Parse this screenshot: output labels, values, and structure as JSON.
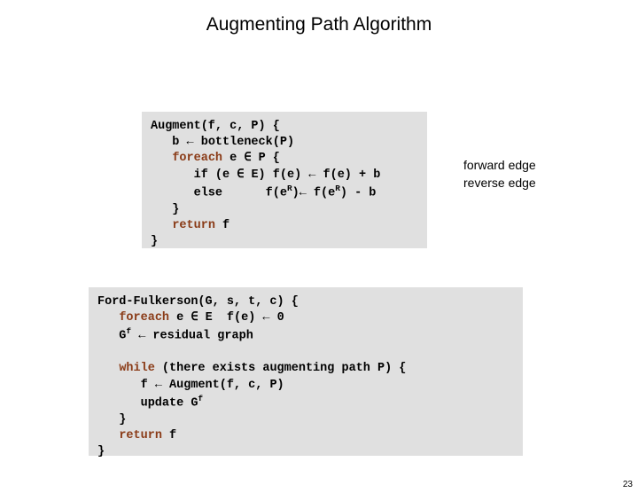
{
  "title": "Augmenting Path Algorithm",
  "augment": {
    "l1a": "Augment(f, c, P) {",
    "l2a": "   b ",
    "l2b": " bottleneck(P)",
    "l3a": "   ",
    "l3kw": "foreach",
    "l3b": " e ",
    "l3c": " P {",
    "l4a": "      if (e ",
    "l4b": " E) f(e) ",
    "l4c": " f(e) + b",
    "l5a": "      else      f(e",
    "l5sup": "R",
    "l5b": ")",
    "l5c": " f(e",
    "l5sup2": "R",
    "l5d": ") - b",
    "l6": "   }",
    "l7a": "   ",
    "l7kw": "return",
    "l7b": " f",
    "l8": "}"
  },
  "annotations": {
    "forward": "forward edge",
    "reverse": "reverse edge"
  },
  "ff": {
    "l1": "Ford-Fulkerson(G, s, t, c) {",
    "l2a": "   ",
    "l2kw": "foreach",
    "l2b": " e ",
    "l2c": " E  f(e) ",
    "l2d": " 0",
    "l3a": "   G",
    "l3sub": "f",
    "l3b": " ",
    "l3c": " residual graph",
    "blank1": " ",
    "l4a": "   ",
    "l4kw": "while",
    "l4b": " (there exists augmenting path P) {",
    "l5a": "      f ",
    "l5b": " Augment(f, c, P)",
    "l6a": "      update G",
    "l6sub": "f",
    "l7": "   }",
    "l8a": "   ",
    "l8kw": "return",
    "l8b": " f",
    "l9": "}"
  },
  "symbols": {
    "larrow": "←",
    "in": "∈"
  },
  "pagenum": "23"
}
